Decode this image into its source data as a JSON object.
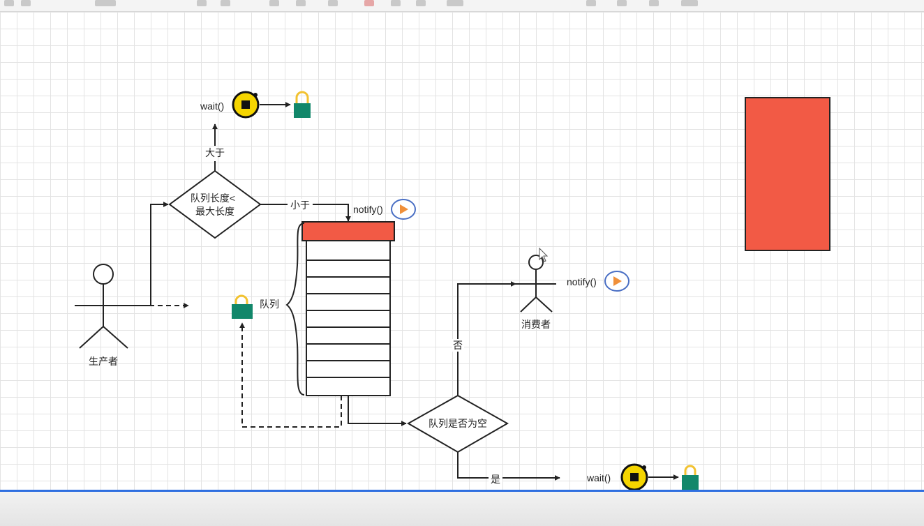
{
  "colors": {
    "queue_head": "#f25a45",
    "red_block": "#f25a45",
    "lock_body": "#12876a",
    "lock_shackle": "#f2c230",
    "stop_fill": "#f5d500",
    "play_ring": "#4a6fc4",
    "play_triangle": "#f0903a",
    "selection_bar": "#2f6fe0"
  },
  "labels": {
    "producer": "生产者",
    "consumer": "消费者",
    "queue": "队列",
    "decision_full_line1": "队列长度<",
    "decision_full_line2": "最大长度",
    "decision_empty": "队列是否为空",
    "edge_greater": "大于",
    "edge_less": "小于",
    "edge_no": "否",
    "edge_yes": "是",
    "wait_top": "wait()",
    "notify_queue": "notify()",
    "notify_consumer": "notify()",
    "wait_bottom": "wait()"
  },
  "icons": {
    "stop": "stop-icon",
    "play": "play-icon",
    "lock": "lock-icon",
    "person": "stick-figure-icon"
  },
  "queue": {
    "empty_slots": 9
  }
}
